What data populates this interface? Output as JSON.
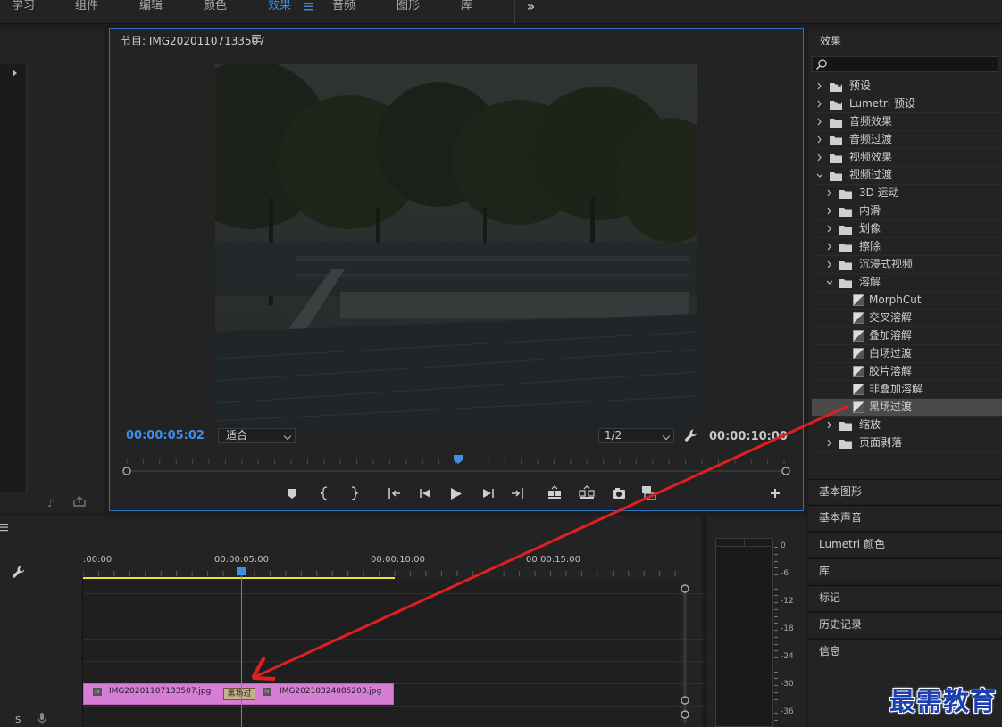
{
  "workspace_tabs": [
    {
      "label": "学习"
    },
    {
      "label": "组件"
    },
    {
      "label": "编辑"
    },
    {
      "label": "颜色"
    },
    {
      "label": "效果"
    },
    {
      "label": "音频"
    },
    {
      "label": "图形"
    },
    {
      "label": "库"
    }
  ],
  "workspace_active": "效果",
  "program": {
    "title": "节目: IMG20201107133507",
    "timecode_current": "00:00:05:02",
    "fit_value": "适合",
    "resolution_value": "1/2",
    "timecode_duration": "00:00:10:00"
  },
  "effects": {
    "title": "效果",
    "tree": [
      {
        "label": "预设",
        "level": 0,
        "expanded": false,
        "kind": "preset-folder"
      },
      {
        "label": "Lumetri 预设",
        "level": 0,
        "expanded": false,
        "kind": "preset-folder"
      },
      {
        "label": "音频效果",
        "level": 0,
        "expanded": false,
        "kind": "folder"
      },
      {
        "label": "音频过渡",
        "level": 0,
        "expanded": false,
        "kind": "folder"
      },
      {
        "label": "视频效果",
        "level": 0,
        "expanded": false,
        "kind": "folder"
      },
      {
        "label": "视频过渡",
        "level": 0,
        "expanded": true,
        "kind": "folder"
      },
      {
        "label": "3D 运动",
        "level": 1,
        "expanded": false,
        "kind": "folder"
      },
      {
        "label": "内滑",
        "level": 1,
        "expanded": false,
        "kind": "folder"
      },
      {
        "label": "划像",
        "level": 1,
        "expanded": false,
        "kind": "folder"
      },
      {
        "label": "擦除",
        "level": 1,
        "expanded": false,
        "kind": "folder"
      },
      {
        "label": "沉浸式视频",
        "level": 1,
        "expanded": false,
        "kind": "folder"
      },
      {
        "label": "溶解",
        "level": 1,
        "expanded": true,
        "kind": "folder"
      },
      {
        "label": "MorphCut",
        "level": 2,
        "kind": "transition"
      },
      {
        "label": "交叉溶解",
        "level": 2,
        "kind": "transition"
      },
      {
        "label": "叠加溶解",
        "level": 2,
        "kind": "transition"
      },
      {
        "label": "白场过渡",
        "level": 2,
        "kind": "transition"
      },
      {
        "label": "胶片溶解",
        "level": 2,
        "kind": "transition"
      },
      {
        "label": "非叠加溶解",
        "level": 2,
        "kind": "transition"
      },
      {
        "label": "黑场过渡",
        "level": 2,
        "kind": "transition",
        "selected": true
      },
      {
        "label": "缩放",
        "level": 1,
        "expanded": false,
        "kind": "folder"
      },
      {
        "label": "页面剥落",
        "level": 1,
        "expanded": false,
        "kind": "folder"
      }
    ]
  },
  "side_sections": [
    {
      "label": "基本图形"
    },
    {
      "label": "基本声音"
    },
    {
      "label": "Lumetri 颜色"
    },
    {
      "label": "库"
    },
    {
      "label": "标记"
    },
    {
      "label": "历史记录"
    },
    {
      "label": "信息"
    }
  ],
  "timeline": {
    "ruler_labels": [
      ":00:00",
      "00:00:05:00",
      "00:00:10:00",
      "00:00:15:00"
    ],
    "clip_a_name": "IMG20201107133507.jpg",
    "clip_b_name": "IMG20210324085203.jpg",
    "transition_label": "黑场过",
    "fx_label": "fx",
    "track_label_s": "S"
  },
  "audio_meter": {
    "db_labels": [
      "0",
      "-6",
      "-12",
      "-18",
      "-24",
      "-30",
      "-36"
    ]
  },
  "watermark": "最需教育",
  "colors": {
    "accent_blue": "#3d8ee6",
    "clip_pink": "#d67dd5",
    "work_area_yellow": "#e8e33a",
    "arrow_red": "#e02020",
    "watermark_blue": "#1c3fb0"
  }
}
